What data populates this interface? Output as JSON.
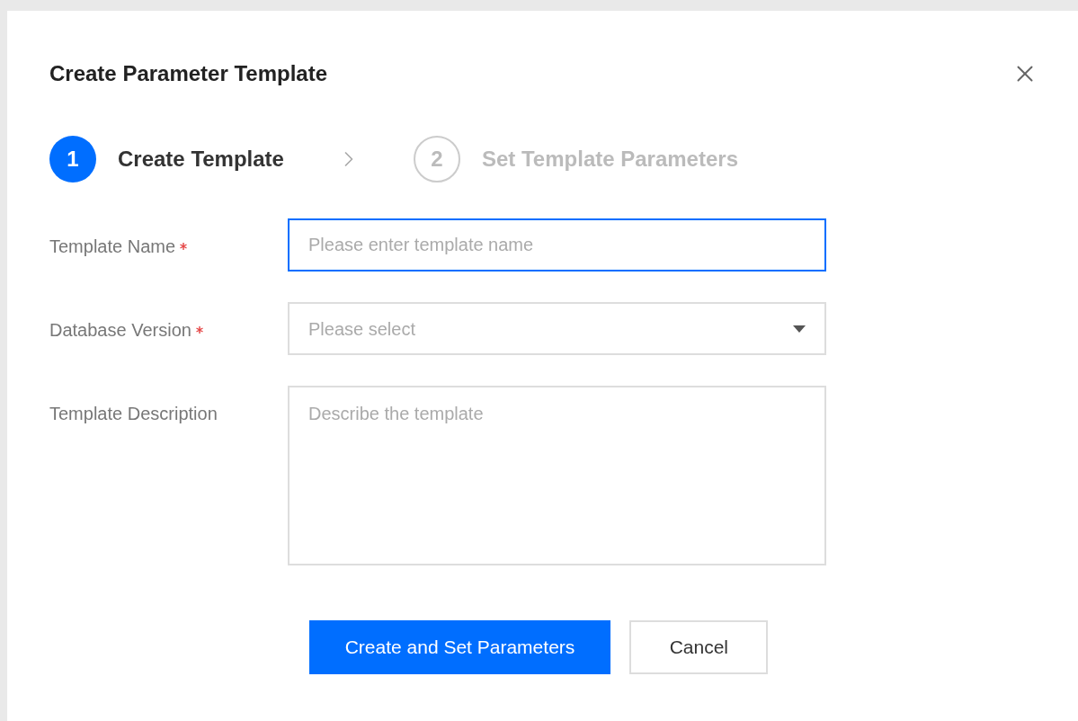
{
  "dialog": {
    "title": "Create Parameter Template"
  },
  "steps": [
    {
      "number": "1",
      "label": "Create Template",
      "selected": true
    },
    {
      "number": "2",
      "label": "Set Template Parameters",
      "selected": false
    }
  ],
  "fields": [
    {
      "kind": "text",
      "label": "Template Name",
      "required": true,
      "placeholder": "Please enter template name",
      "focused": true
    },
    {
      "kind": "select",
      "label": "Database Version",
      "required": true,
      "placeholder": "Please select",
      "focused": false
    },
    {
      "kind": "textarea",
      "label": "Template Description",
      "required": false,
      "placeholder": "Describe the template",
      "focused": false
    }
  ],
  "buttons": [
    {
      "kind": "primary",
      "label": "Create and Set Parameters"
    },
    {
      "kind": "secondary",
      "label": "Cancel"
    }
  ]
}
